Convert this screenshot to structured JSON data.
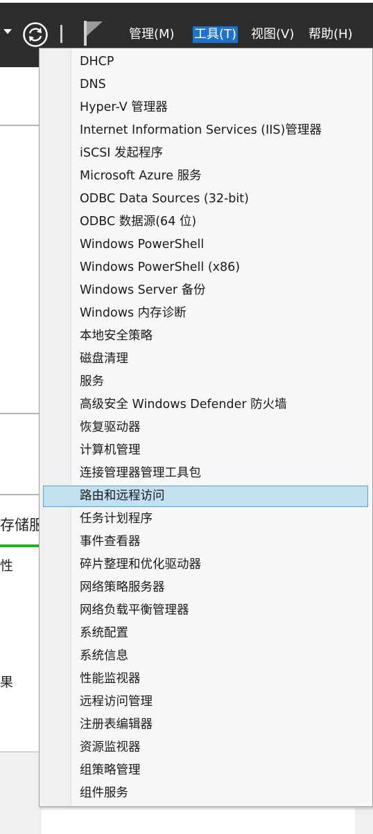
{
  "menubar": {
    "manage": "管理(M)",
    "tools": "工具(T)",
    "view": "视图(V)",
    "help": "帮助(H)"
  },
  "background": {
    "storage_heading": "存储服",
    "line_item_1": "性",
    "line_item_2": "果"
  },
  "tools_menu": {
    "selected_index": 19,
    "items": [
      "DHCP",
      "DNS",
      "Hyper-V 管理器",
      "Internet Information Services (IIS)管理器",
      "iSCSI 发起程序",
      "Microsoft Azure 服务",
      "ODBC Data Sources (32-bit)",
      "ODBC 数据源(64 位)",
      "Windows PowerShell",
      "Windows PowerShell (x86)",
      "Windows Server 备份",
      "Windows 内存诊断",
      "本地安全策略",
      "磁盘清理",
      "服务",
      "高级安全 Windows Defender 防火墙",
      "恢复驱动器",
      "计算机管理",
      "连接管理器管理工具包",
      "路由和远程访问",
      "任务计划程序",
      "事件查看器",
      "碎片整理和优化驱动器",
      "网络策略服务器",
      "网络负载平衡管理器",
      "系统配置",
      "系统信息",
      "性能监视器",
      "远程访问管理",
      "注册表编辑器",
      "资源监视器",
      "组策略管理",
      "组件服务"
    ]
  },
  "colors": {
    "titlebar": "#2d2d30",
    "menu_active": "#1e73c8",
    "selection_fill": "#c3e0f0",
    "selection_border": "#4fa3d6",
    "status_green": "#1fb31f"
  }
}
